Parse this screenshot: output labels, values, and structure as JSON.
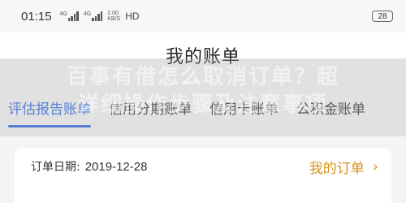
{
  "status_bar": {
    "time": "01:15",
    "signal_1_label": "4G",
    "signal_2_label": "4G",
    "speed_value": "2.00",
    "speed_unit": "KB/S",
    "hd_label": "HD",
    "battery_level": "28"
  },
  "header": {
    "title": "我的账单"
  },
  "tabs": [
    {
      "label": "评估报告账单",
      "active": true
    },
    {
      "label": "信用分期账单",
      "active": false
    },
    {
      "label": "信用卡账单",
      "active": false
    },
    {
      "label": "公积金账单",
      "active": false
    }
  ],
  "overlay": {
    "line1": "百事有借怎么取消订单？超",
    "line2": "详细操作步骤及注意事项"
  },
  "order_card": {
    "date_label": "订单日期:",
    "date_value": "2019-12-28",
    "link_label": "我的订单",
    "chevron": "›"
  },
  "colors": {
    "accent_blue": "#2a6be8",
    "accent_orange": "#d9931e"
  }
}
